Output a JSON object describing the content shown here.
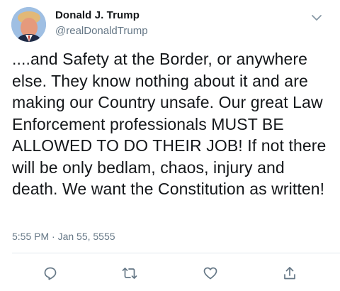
{
  "author": {
    "name": "Donald J. Trump",
    "handle": "@realDonaldTrump"
  },
  "tweet": {
    "text": "....and Safety at the Border, or anywhere else. They know nothing about it and are making our Country unsafe. Our great Law Enforcement professionals MUST BE ALLOWED TO DO THEIR JOB! If not there will be only bedlam, chaos, injury and death. We want the Constitution as written!",
    "timestamp": "5:55 PM · Jan 55, 5555"
  },
  "icons": {
    "more": "chevron-down-icon",
    "reply": "reply-icon",
    "retweet": "retweet-icon",
    "like": "heart-icon",
    "share": "share-icon"
  },
  "colors": {
    "text": "#14171a",
    "secondary": "#657786",
    "icon": "#657786",
    "divider": "#e1e8ed"
  }
}
